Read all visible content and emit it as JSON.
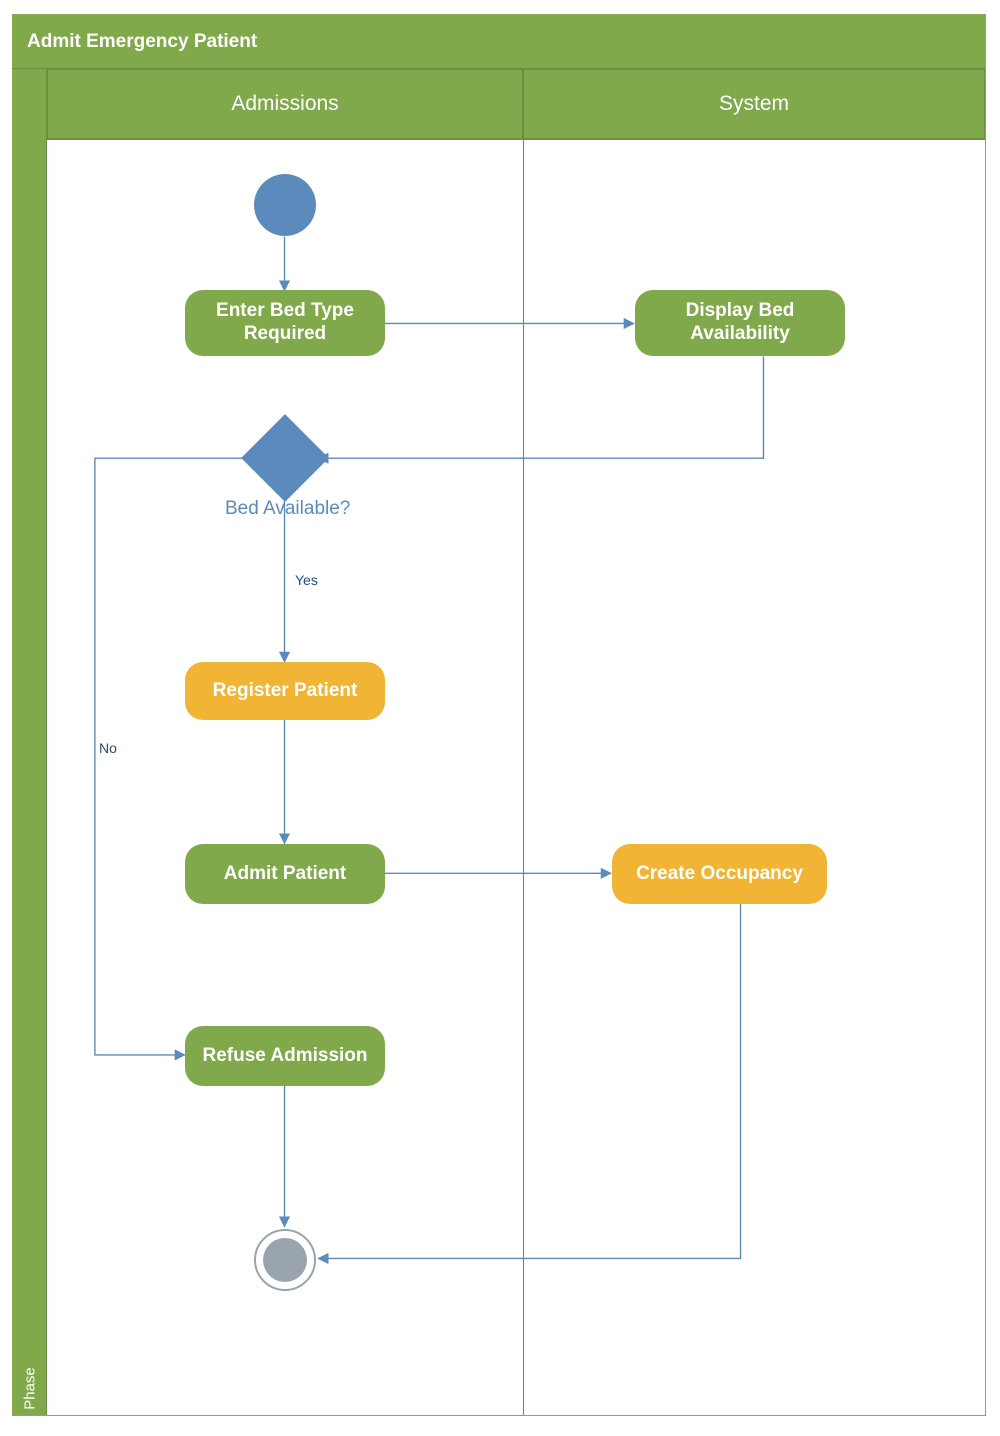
{
  "title": "Admit Emergency Patient",
  "phase_label": "Phase",
  "lanes": {
    "admissions": "Admissions",
    "system": "System"
  },
  "nodes": {
    "enter_bed_type": "Enter Bed Type Required",
    "display_bed": "Display Bed Availability",
    "decision_label": "Bed Available?",
    "register_patient": "Register Patient",
    "admit_patient": "Admit Patient",
    "create_occupancy": "Create Occupancy",
    "refuse_admission": "Refuse Admission"
  },
  "edge_labels": {
    "yes": "Yes",
    "no": "No"
  }
}
